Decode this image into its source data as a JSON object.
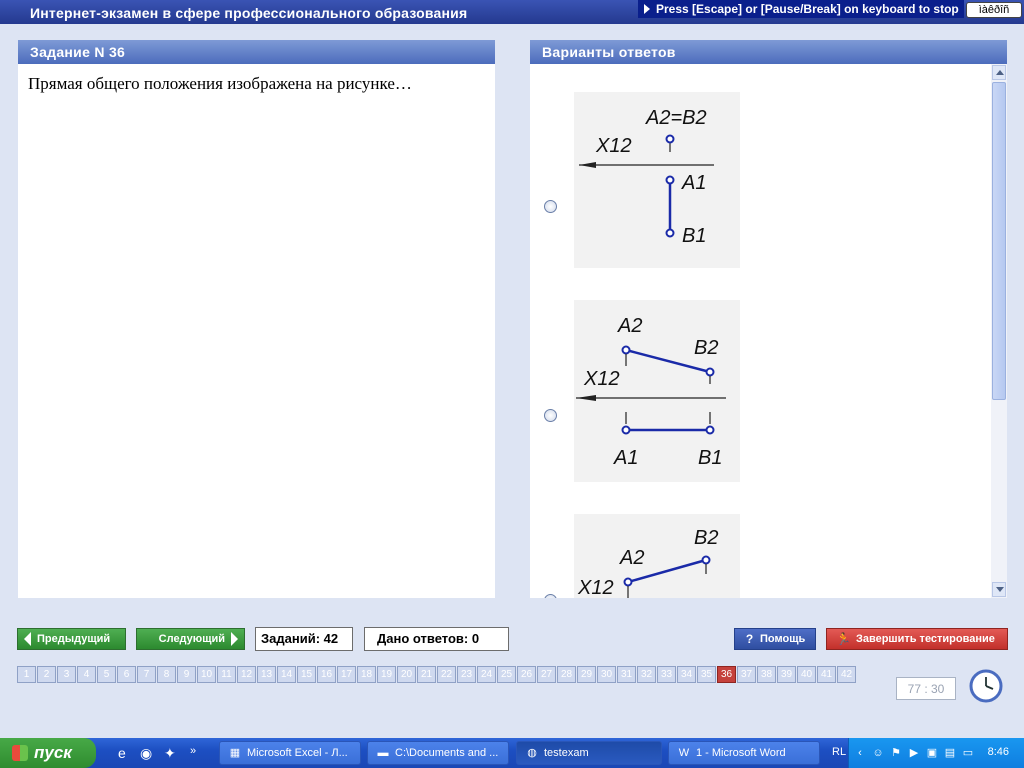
{
  "window": {
    "title": "Интернет-экзамен в сфере профессионального образования",
    "escape_note": "Press [Escape] or [Pause/Break] on keyboard to stop",
    "kbd_label": "ìàêðîñ"
  },
  "question": {
    "header": "Задание N 36",
    "text": "Прямая общего положения изображена на рисунке…"
  },
  "answers": {
    "header": "Варианты ответов",
    "options": [
      {
        "point_labels": [
          "A2=B2",
          "A1",
          "B1"
        ],
        "axis_label": "X12"
      },
      {
        "point_labels": [
          "A2",
          "B2",
          "A1",
          "B1"
        ],
        "axis_label": "X12"
      },
      {
        "point_labels": [
          "A2",
          "B2"
        ],
        "axis_label": "X12"
      }
    ]
  },
  "toolbar": {
    "prev_label": "Предыдущий",
    "next_label": "Следующий",
    "tasks_label": "Заданий: 42",
    "answered_label": "Дано ответов: 0",
    "help_label": "Помощь",
    "finish_label": "Завершить тестирование",
    "task_numbers": [
      "1",
      "2",
      "3",
      "4",
      "5",
      "6",
      "7",
      "8",
      "9",
      "10",
      "11",
      "12",
      "13",
      "14",
      "15",
      "16",
      "17",
      "18",
      "19",
      "20",
      "21",
      "22",
      "23",
      "24",
      "25",
      "26",
      "27",
      "28",
      "29",
      "30",
      "31",
      "32",
      "33",
      "34",
      "35",
      "36",
      "37",
      "38",
      "39",
      "40",
      "41",
      "42"
    ],
    "current_task": "36",
    "timer": "77 : 30"
  },
  "taskbar": {
    "start_label": "пуск",
    "items": [
      {
        "label": "Microsoft Excel - Л...",
        "icon": "excel-icon"
      },
      {
        "label": "C:\\Documents and ...",
        "icon": "folder-icon"
      },
      {
        "label": "testexam",
        "icon": "app-icon",
        "active": true
      },
      {
        "label": "1 - Microsoft Word",
        "icon": "word-icon"
      }
    ],
    "language": "RL",
    "clock": "8:46"
  },
  "colors": {
    "title_bar": "#24398f",
    "panel_header": "#4c6cbc",
    "prev_next_green": "#2c8a2f",
    "finish_red": "#c2302b",
    "help_blue": "#2f4ea0",
    "current_task": "#c5413c",
    "figure_line": "#1a2aa8"
  }
}
